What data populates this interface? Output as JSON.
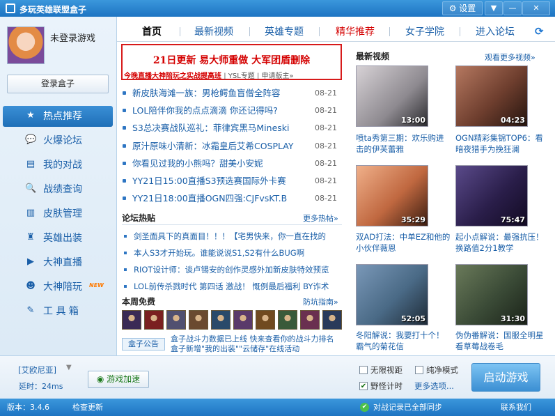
{
  "window": {
    "title": "多玩英雄联盟盒子",
    "settings_label": "⚙ 设置"
  },
  "user": {
    "name": "未登录游戏",
    "login_label": "登录盒子"
  },
  "sidebar": {
    "items": [
      {
        "label": "热点推荐",
        "icon": "★"
      },
      {
        "label": "火爆论坛",
        "icon": "💬"
      },
      {
        "label": "我的对战",
        "icon": "▤"
      },
      {
        "label": "战绩查询",
        "icon": "🔍"
      },
      {
        "label": "皮肤管理",
        "icon": "▥"
      },
      {
        "label": "英雄出装",
        "icon": "♜"
      },
      {
        "label": "大神直播",
        "icon": "▶"
      },
      {
        "label": "大神陪玩",
        "icon": "☻",
        "badge": "NEW"
      },
      {
        "label": "工 具 箱",
        "icon": "✎"
      }
    ]
  },
  "tabs": [
    "首页",
    "最新视频",
    "英雄专题",
    "精华推荐",
    "女子学院",
    "进入论坛"
  ],
  "banner": {
    "headline": "21日更新  易大师重做  大军团盾删除",
    "sub_red": "今晚直播大神陪玩之实战提高班",
    "sub_link1": "YSL专题",
    "sub_link2": "申请版主»"
  },
  "news": [
    {
      "title": "新皮肤海滩一族：男枪鳄鱼盲僧全阵容",
      "date": "08-21"
    },
    {
      "title": "LOL陪伴你我的点点滴滴 你还记得吗?",
      "date": "08-21"
    },
    {
      "title": "S3总决赛战队巡礼：菲律宾黑马Mineski",
      "date": "08-21"
    },
    {
      "title": "原汁原味小清新：冰霜皇后艾希COSPLAY",
      "date": "08-21"
    },
    {
      "title": "你看见过我的小熊吗？甜美小安妮",
      "date": "08-21"
    },
    {
      "title": "YY21日15:00直播S3预选赛国际外卡赛",
      "date": "08-21"
    },
    {
      "title": "YY21日18:00直播OGN四强:CJFvsKT.B",
      "date": "08-21"
    }
  ],
  "forum": {
    "heading": "论坛热贴",
    "more": "更多热帖»",
    "items": [
      "剑圣面具下的真面目！！！【宅男快来，你一直在找的",
      "本人S3才开始玩。谁能说说S1,S2有什么BUG啊",
      "RIOT设计师：谈卢锡安的创作灵感外加新皮肤特效预览",
      "LOL前传杀戮时代 第四话 激战！ 慨例最后福利 BY诈术"
    ]
  },
  "free": {
    "heading": "本周免费",
    "more": "防坑指南»",
    "heroes": [
      "#3a2a55",
      "#7a2020",
      "#505070",
      "#6a4a30",
      "#2a4a6a",
      "#5a3a6a",
      "#704a20",
      "#3a5a3a",
      "#6a3050",
      "#2a3a5a"
    ]
  },
  "notice": {
    "tab": "盒子公告",
    "text": "盒子战斗力数据已上线 快来查看你的战斗力排名 盒子新增\"我的出装\"\"云储存\"在线活动"
  },
  "videos": {
    "heading": "最新视频",
    "more": "观看更多视频»",
    "items": [
      {
        "duration": "13:00",
        "caption": "喷ta秀第三期：欢乐购进击的伊芙蕾雅"
      },
      {
        "duration": "04:23",
        "caption": "OGN精彩集锦TOP6：看暗夜猎手为挽狂澜"
      },
      {
        "duration": "35:29",
        "caption": "双AD打法：中单EZ和他的小伙伴薇恩"
      },
      {
        "duration": "75:47",
        "caption": "起小点解说：最强抗压！换路值2分1教学"
      },
      {
        "duration": "52:05",
        "caption": "冬阳解说：我要打十个！霸气的菊花信"
      },
      {
        "duration": "31:30",
        "caption": "伪伪番解说：国服全明星 看草莓战卷毛"
      }
    ]
  },
  "bottom": {
    "server": "[艾欧尼亚]",
    "latency": "延时：24ms",
    "speed_label": "游戏加速",
    "opt_nolimit": "无限视距",
    "opt_pure": "纯净模式",
    "opt_timer": "野怪计时",
    "more_opts": "更多选项...",
    "launch": "启动游戏"
  },
  "status": {
    "version": "版本：3.4.6",
    "check_update": "检查更新",
    "sync": "对战记录已全部同步",
    "contact": "联系我们"
  }
}
